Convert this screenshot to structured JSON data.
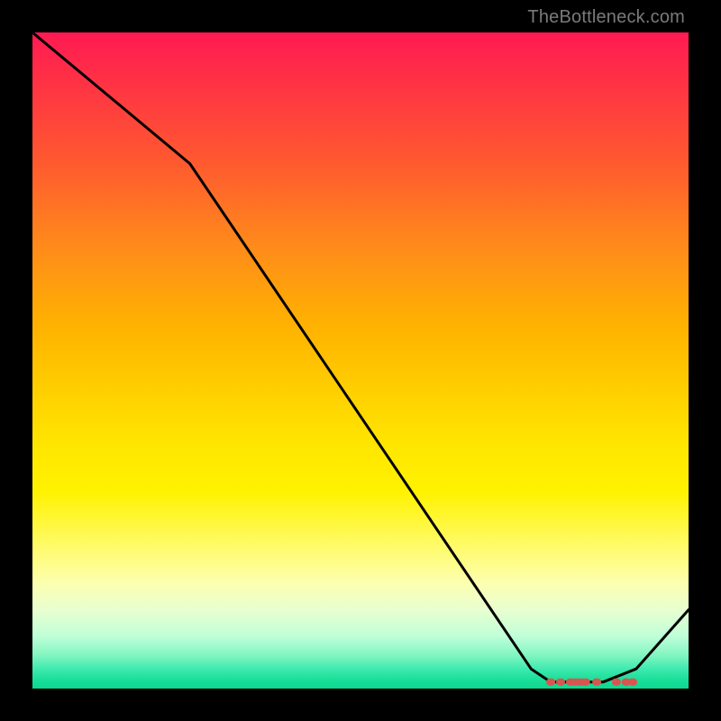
{
  "attribution": "TheBottleneck.com",
  "chart_data": {
    "type": "line",
    "title": "",
    "xlabel": "",
    "ylabel": "",
    "xlim": [
      0,
      100
    ],
    "ylim": [
      0,
      100
    ],
    "series": [
      {
        "name": "curve",
        "x": [
          0,
          24,
          76,
          79,
          87,
          92,
          100
        ],
        "values": [
          100,
          80,
          3,
          1,
          1,
          3,
          12
        ]
      }
    ],
    "markers": {
      "name": "flat-segment-markers",
      "color": "#d9554f",
      "shape": "pill",
      "x": [
        79,
        80.5,
        82,
        82.8,
        83.5,
        84.3,
        86,
        89,
        90.5,
        91.5
      ],
      "values": [
        1,
        1,
        1,
        1,
        1,
        1,
        1,
        1,
        1,
        1
      ]
    },
    "background_gradient": {
      "top": "#ff1a52",
      "mid": "#ffe600",
      "bottom": "#0ad890"
    }
  },
  "colors": {
    "frame": "#000000",
    "line": "#000000",
    "marker": "#d9554f",
    "attribution_text": "#7a7a7a"
  }
}
